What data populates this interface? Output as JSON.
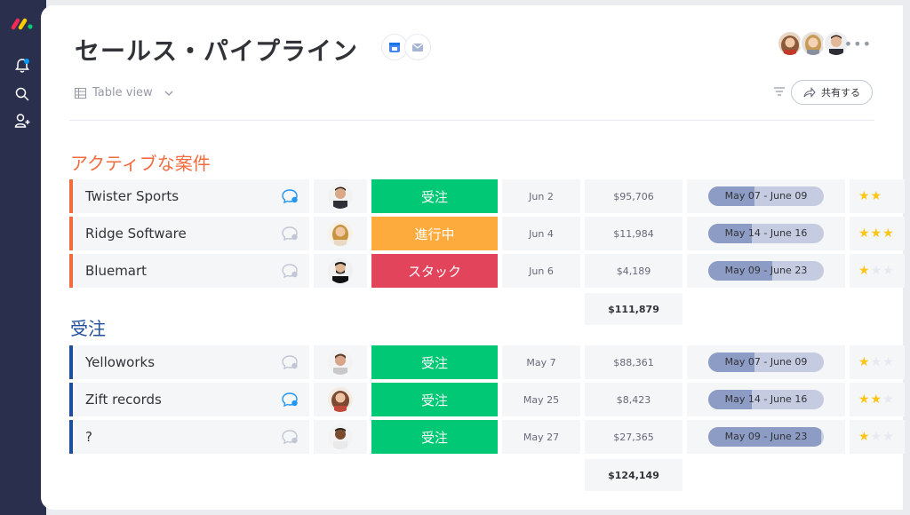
{
  "board": {
    "title": "セールス・パイプライン",
    "view_label": "Table view",
    "share_label": "共有する"
  },
  "colors": {
    "active_group": "#f06b3e",
    "won_group": "#1f4e9b",
    "won_status": "#00c875",
    "progress_status": "#fdab3d",
    "stuck_status": "#e2445c",
    "chat_active": "#2196f3",
    "star_on": "#fdc516"
  },
  "groups": [
    {
      "title": "アクティブな案件",
      "rows": [
        {
          "name": "Twister Sports",
          "chat_active": true,
          "status": "受注",
          "status_color": "#00c875",
          "date": "Jun 2",
          "amount": "$95,706",
          "timeline": "May 07 - June 09",
          "timeline_progress": 0.4,
          "stars": "★★",
          "rating": 2
        },
        {
          "name": "Ridge Software",
          "chat_active": false,
          "status": "進行中",
          "status_color": "#fdab3d",
          "date": "Jun 4",
          "amount": "$11,984",
          "timeline": "May 14 - June 16",
          "timeline_progress": 0.38,
          "stars": "★★★",
          "rating": 3
        },
        {
          "name": "Bluemart",
          "chat_active": false,
          "status": "スタック",
          "status_color": "#e2445c",
          "date": "Jun 6",
          "amount": "$4,189",
          "timeline": "May 09 - June 23",
          "timeline_progress": 0.55,
          "stars": "★★★",
          "rating": 1
        }
      ],
      "sum": "$111,879"
    },
    {
      "title": "受注",
      "rows": [
        {
          "name": "Yelloworks",
          "chat_active": false,
          "status": "受注",
          "status_color": "#00c875",
          "date": "May 7",
          "amount": "$88,361",
          "timeline": "May 07 - June 09",
          "timeline_progress": 0.4,
          "stars": "★★★",
          "rating": 1
        },
        {
          "name": "Zift records",
          "chat_active": true,
          "status": "受注",
          "status_color": "#00c875",
          "date": "May 25",
          "amount": "$8,423",
          "timeline": "May 14 - June 16",
          "timeline_progress": 0.38,
          "stars": "★★",
          "rating": 2
        },
        {
          "name": "?",
          "chat_active": false,
          "status": "受注",
          "status_color": "#00c875",
          "date": "May 27",
          "amount": "$27,365",
          "timeline": "May 09 - June 23",
          "timeline_progress": 0.98,
          "stars": "★★★",
          "rating": 1
        }
      ],
      "sum": "$124,149"
    }
  ]
}
